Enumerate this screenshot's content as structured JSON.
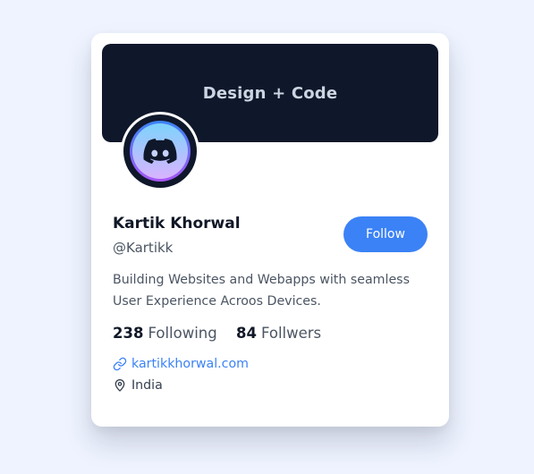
{
  "banner": {
    "title": "Design + Code"
  },
  "avatar": {
    "icon": "discord-logo-icon"
  },
  "profile": {
    "name": "Kartik Khorwal",
    "handle": "@Kartikk",
    "bio": "Building Websites and Webapps with seamless User Experience Acroos Devices."
  },
  "follow_button": {
    "label": "Follow"
  },
  "stats": {
    "following_count": "238",
    "following_label": "Following",
    "followers_count": "84",
    "followers_label": "Follwers"
  },
  "links": {
    "website": "kartikkhorwal.com",
    "location": "India"
  },
  "colors": {
    "accent": "#3b82f6",
    "banner": "#0f172a",
    "background": "#eef3ff"
  }
}
